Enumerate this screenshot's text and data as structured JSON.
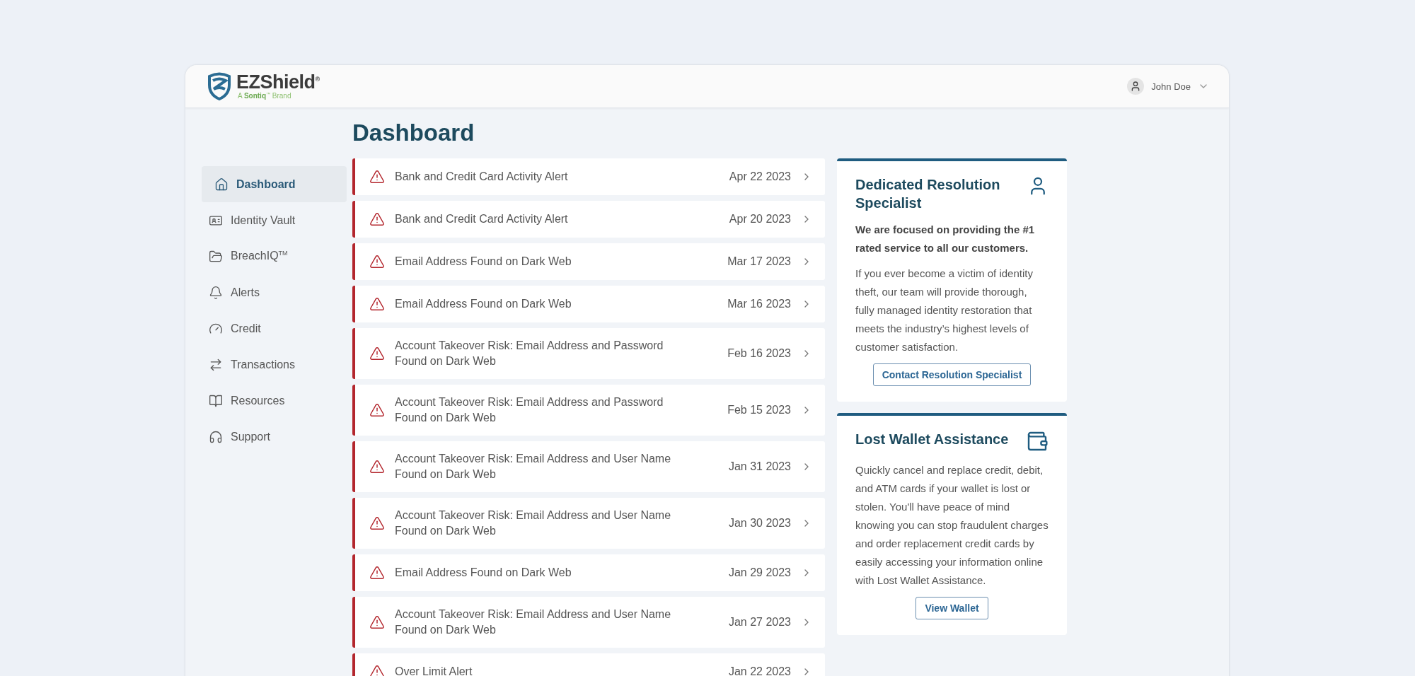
{
  "header": {
    "logo": {
      "name": "EZShield$^{®}$",
      "tagline": "A **Sontiq**$^{™}$ Brand"
    },
    "user": {
      "name": "John Doe"
    }
  },
  "sidebar": {
    "items": [
      {
        "label": "Dashboard",
        "selected": true
      },
      {
        "label": "Identity Vault",
        "selected": false
      },
      {
        "label": "BreachIQ$^{TM}$",
        "selected": false
      },
      {
        "label": "Alerts",
        "selected": false
      },
      {
        "label": "Credit",
        "selected": false
      },
      {
        "label": "Transactions",
        "selected": false
      },
      {
        "label": "Resources",
        "selected": false
      },
      {
        "label": "Support",
        "selected": false
      }
    ]
  },
  "page_title": "Dashboard",
  "alerts": [
    {
      "title": "Bank and Credit Card Activity Alert",
      "date": "Apr 22 2023"
    },
    {
      "title": "Bank and Credit Card Activity Alert",
      "date": "Apr 20 2023"
    },
    {
      "title": "Email Address Found on Dark Web",
      "date": "Mar 17 2023"
    },
    {
      "title": "Email Address Found on Dark Web",
      "date": "Mar 16 2023"
    },
    {
      "title": "Account Takeover Risk: Email Address and Password Found on Dark Web",
      "date": "Feb 16 2023"
    },
    {
      "title": "Account Takeover Risk: Email Address and Password Found on Dark Web",
      "date": "Feb 15 2023"
    },
    {
      "title": "Account Takeover Risk: Email Address and User Name Found on Dark Web",
      "date": "Jan 31 2023"
    },
    {
      "title": "Account Takeover Risk: Email Address and User Name Found on Dark Web",
      "date": "Jan 30 2023"
    },
    {
      "title": "Email Address Found on Dark Web",
      "date": "Jan 29 2023"
    },
    {
      "title": "Account Takeover Risk: Email Address and User Name Found on Dark Web",
      "date": "Jan 27 2023"
    },
    {
      "title": "Over Limit Alert",
      "date": "Jan 22 2023"
    }
  ],
  "cards": [
    {
      "kind": "specialist",
      "title": "Dedicated Resolution Specialist",
      "lead": "We are focused on providing the #1 rated service to all our customers.",
      "body": "If you ever become a victim of identity theft, our team will provide thorough, fully managed identity restoration that meets the industry’s highest levels of customer satisfaction.",
      "button": "Contact Resolution Specialist"
    },
    {
      "kind": "wallet",
      "title": "Lost Wallet Assistance",
      "body": "Quickly cancel and replace credit, debit, and ATM cards if your wallet is lost or stolen. You'll have peace of mind knowing you can stop fraudulent charges and order replacement credit cards by easily accessing your information online with Lost Wallet Assistance.",
      "button": "View Wallet"
    }
  ]
}
